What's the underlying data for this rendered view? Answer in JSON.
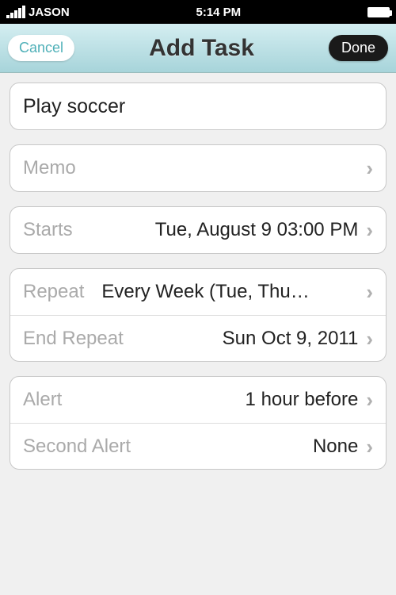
{
  "status": {
    "carrier": "JASON",
    "time": "5:14 PM"
  },
  "nav": {
    "cancel": "Cancel",
    "title": "Add Task",
    "done": "Done"
  },
  "task": {
    "title": "Play soccer"
  },
  "memo": {
    "label": "Memo"
  },
  "starts": {
    "label": "Starts",
    "value": "Tue, August 9 03:00 PM"
  },
  "repeat": {
    "label": "Repeat",
    "value": "Every Week (Tue, Thu…"
  },
  "endRepeat": {
    "label": "End Repeat",
    "value": "Sun Oct 9, 2011"
  },
  "alert": {
    "label": "Alert",
    "value": "1 hour before"
  },
  "secondAlert": {
    "label": "Second Alert",
    "value": "None"
  }
}
